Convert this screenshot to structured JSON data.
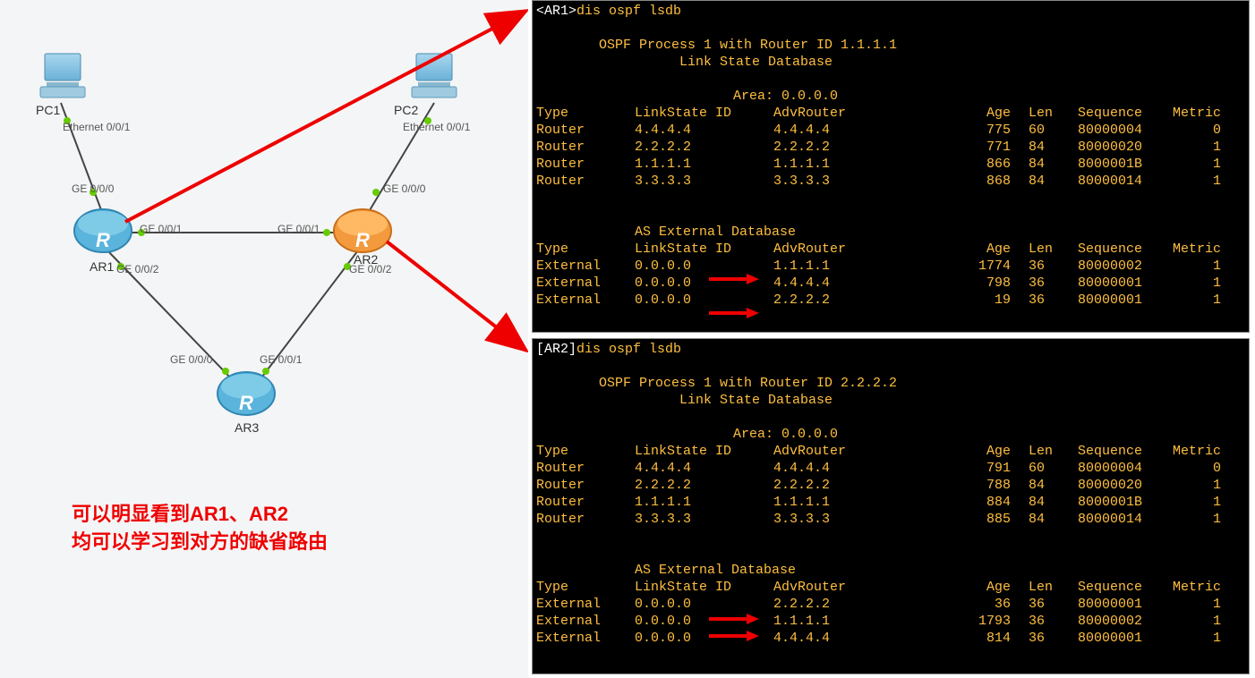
{
  "topology": {
    "pc1": {
      "label": "PC1",
      "port": "Ethernet 0/0/1"
    },
    "pc2": {
      "label": "PC2",
      "port": "Ethernet 0/0/1"
    },
    "ar1": {
      "label": "AR1"
    },
    "ar2": {
      "label": "AR2"
    },
    "ar3": {
      "label": "AR3"
    },
    "ports": {
      "ar1_up": "GE 0/0/0",
      "ar1_right": "GE 0/0/1",
      "ar1_down": "GE 0/0/2",
      "ar2_up": "GE 0/0/0",
      "ar2_left": "GE 0/0/1",
      "ar2_down": "GE 0/0/2",
      "ar3_left": "GE 0/0/0",
      "ar3_right": "GE 0/0/1"
    }
  },
  "note": {
    "line1": "可以明显看到AR1、AR2",
    "line2": "均可以学习到对方的缺省路由"
  },
  "term1": {
    "prompt": "<AR1>",
    "cmd": "dis ospf lsdb",
    "title1": "OSPF Process 1 with Router ID 1.1.1.1",
    "title2": "Link State Database",
    "area": "Area: 0.0.0.0",
    "hdr": {
      "type": "Type",
      "ls": "LinkState ID",
      "adv": "AdvRouter",
      "age": "Age",
      "len": "Len",
      "seq": "Sequence",
      "met": "Metric"
    },
    "rows": [
      {
        "type": "Router",
        "ls": "4.4.4.4",
        "adv": "4.4.4.4",
        "age": "775",
        "len": "60",
        "seq": "80000004",
        "met": "0"
      },
      {
        "type": "Router",
        "ls": "2.2.2.2",
        "adv": "2.2.2.2",
        "age": "771",
        "len": "84",
        "seq": "80000020",
        "met": "1"
      },
      {
        "type": "Router",
        "ls": "1.1.1.1",
        "adv": "1.1.1.1",
        "age": "866",
        "len": "84",
        "seq": "8000001B",
        "met": "1"
      },
      {
        "type": "Router",
        "ls": "3.3.3.3",
        "adv": "3.3.3.3",
        "age": "868",
        "len": "84",
        "seq": "80000014",
        "met": "1"
      }
    ],
    "ext_title": "AS External Database",
    "ext_hdr": {
      "type": "Type",
      "ls": "LinkState ID",
      "adv": "AdvRouter",
      "age": "Age",
      "len": "Len",
      "seq": "Sequence",
      "met": "Metric"
    },
    "ext_rows": [
      {
        "type": "External",
        "ls": "0.0.0.0",
        "adv": "1.1.1.1",
        "age": "1774",
        "len": "36",
        "seq": "80000002",
        "met": "1"
      },
      {
        "type": "External",
        "ls": "0.0.0.0",
        "adv": "4.4.4.4",
        "age": "798",
        "len": "36",
        "seq": "80000001",
        "met": "1"
      },
      {
        "type": "External",
        "ls": "0.0.0.0",
        "adv": "2.2.2.2",
        "age": "19",
        "len": "36",
        "seq": "80000001",
        "met": "1"
      }
    ]
  },
  "term2": {
    "prompt": "[AR2]",
    "cmd": "dis ospf lsdb",
    "title1": "OSPF Process 1 with Router ID 2.2.2.2",
    "title2": "Link State Database",
    "area": "Area: 0.0.0.0",
    "hdr": {
      "type": "Type",
      "ls": "LinkState ID",
      "adv": "AdvRouter",
      "age": "Age",
      "len": "Len",
      "seq": "Sequence",
      "met": "Metric"
    },
    "rows": [
      {
        "type": "Router",
        "ls": "4.4.4.4",
        "adv": "4.4.4.4",
        "age": "791",
        "len": "60",
        "seq": "80000004",
        "met": "0"
      },
      {
        "type": "Router",
        "ls": "2.2.2.2",
        "adv": "2.2.2.2",
        "age": "788",
        "len": "84",
        "seq": "80000020",
        "met": "1"
      },
      {
        "type": "Router",
        "ls": "1.1.1.1",
        "adv": "1.1.1.1",
        "age": "884",
        "len": "84",
        "seq": "8000001B",
        "met": "1"
      },
      {
        "type": "Router",
        "ls": "3.3.3.3",
        "adv": "3.3.3.3",
        "age": "885",
        "len": "84",
        "seq": "80000014",
        "met": "1"
      }
    ],
    "ext_title": "AS External Database",
    "ext_hdr": {
      "type": "Type",
      "ls": "LinkState ID",
      "adv": "AdvRouter",
      "age": "Age",
      "len": "Len",
      "seq": "Sequence",
      "met": "Metric"
    },
    "ext_rows": [
      {
        "type": "External",
        "ls": "0.0.0.0",
        "adv": "2.2.2.2",
        "age": "36",
        "len": "36",
        "seq": "80000001",
        "met": "1"
      },
      {
        "type": "External",
        "ls": "0.0.0.0",
        "adv": "1.1.1.1",
        "age": "1793",
        "len": "36",
        "seq": "80000002",
        "met": "1"
      },
      {
        "type": "External",
        "ls": "0.0.0.0",
        "adv": "4.4.4.4",
        "age": "814",
        "len": "36",
        "seq": "80000001",
        "met": "1"
      }
    ]
  }
}
